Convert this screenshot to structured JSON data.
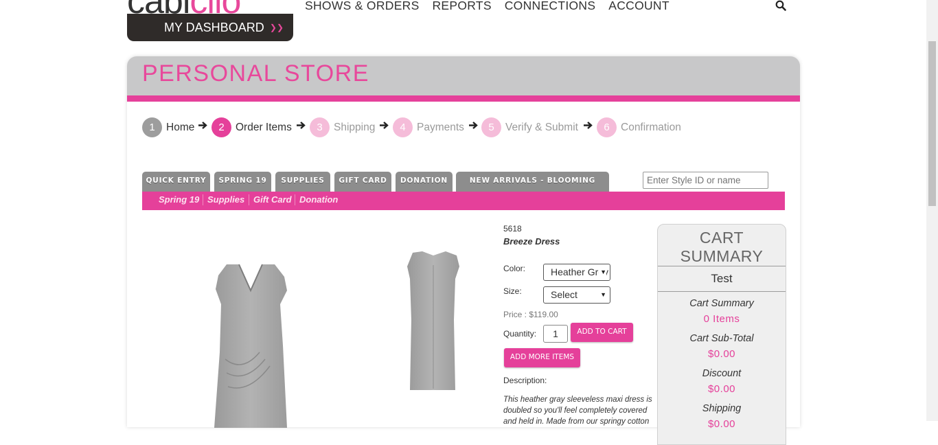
{
  "header": {
    "logo_dark": "cabi",
    "logo_pink": "clio",
    "dashboard_label": "MY DASHBOARD",
    "nav": [
      "SHOWS & ORDERS",
      "REPORTS",
      "CONNECTIONS",
      "ACCOUNT"
    ]
  },
  "store": {
    "title": "PERSONAL STORE",
    "steps": [
      {
        "num": "1",
        "label": "Home",
        "state": "done"
      },
      {
        "num": "2",
        "label": "Order Items",
        "state": "current"
      },
      {
        "num": "3",
        "label": "Shipping",
        "state": "future"
      },
      {
        "num": "4",
        "label": "Payments",
        "state": "future"
      },
      {
        "num": "5",
        "label": "Verify & Submit",
        "state": "future"
      },
      {
        "num": "6",
        "label": "Confirmation",
        "state": "future"
      }
    ],
    "tabs": [
      "QUICK ENTRY",
      "SPRING 19",
      "SUPPLIES",
      "GIFT CARD",
      "DONATION",
      "NEW ARRIVALS - BLOOMING BLUSH"
    ],
    "search_placeholder": "Enter Style ID or name",
    "subnav": [
      "Spring 19",
      "Supplies",
      "Gift Card",
      "Donation"
    ]
  },
  "product": {
    "style_id": "5618",
    "name": "Breeze Dress",
    "color_label": "Color:",
    "color_value": "Heather Grey",
    "size_label": "Size:",
    "size_value": "Select",
    "price_text": "Price : $119.00",
    "quantity_label": "Quantity:",
    "quantity_value": "1",
    "add_to_cart": "ADD TO CART",
    "add_more": "ADD MORE ITEMS",
    "description_label": "Description:",
    "description": "This heather gray sleeveless maxi dress is doubled so you'll feel completely covered and held in. Made from our springy cotton"
  },
  "cart": {
    "title": "CART SUMMARY",
    "customer": "Test",
    "summary_label": "Cart Summary",
    "items": "0 Items",
    "subtotal_label": "Cart Sub-Total",
    "subtotal": "$0.00",
    "discount_label": "Discount",
    "discount": "$0.00",
    "shipping_label": "Shipping",
    "shipping": "$0.00"
  },
  "colors": {
    "accent": "#e5409a",
    "header_gray": "#c8c8c9",
    "dark": "#2f2b29"
  }
}
